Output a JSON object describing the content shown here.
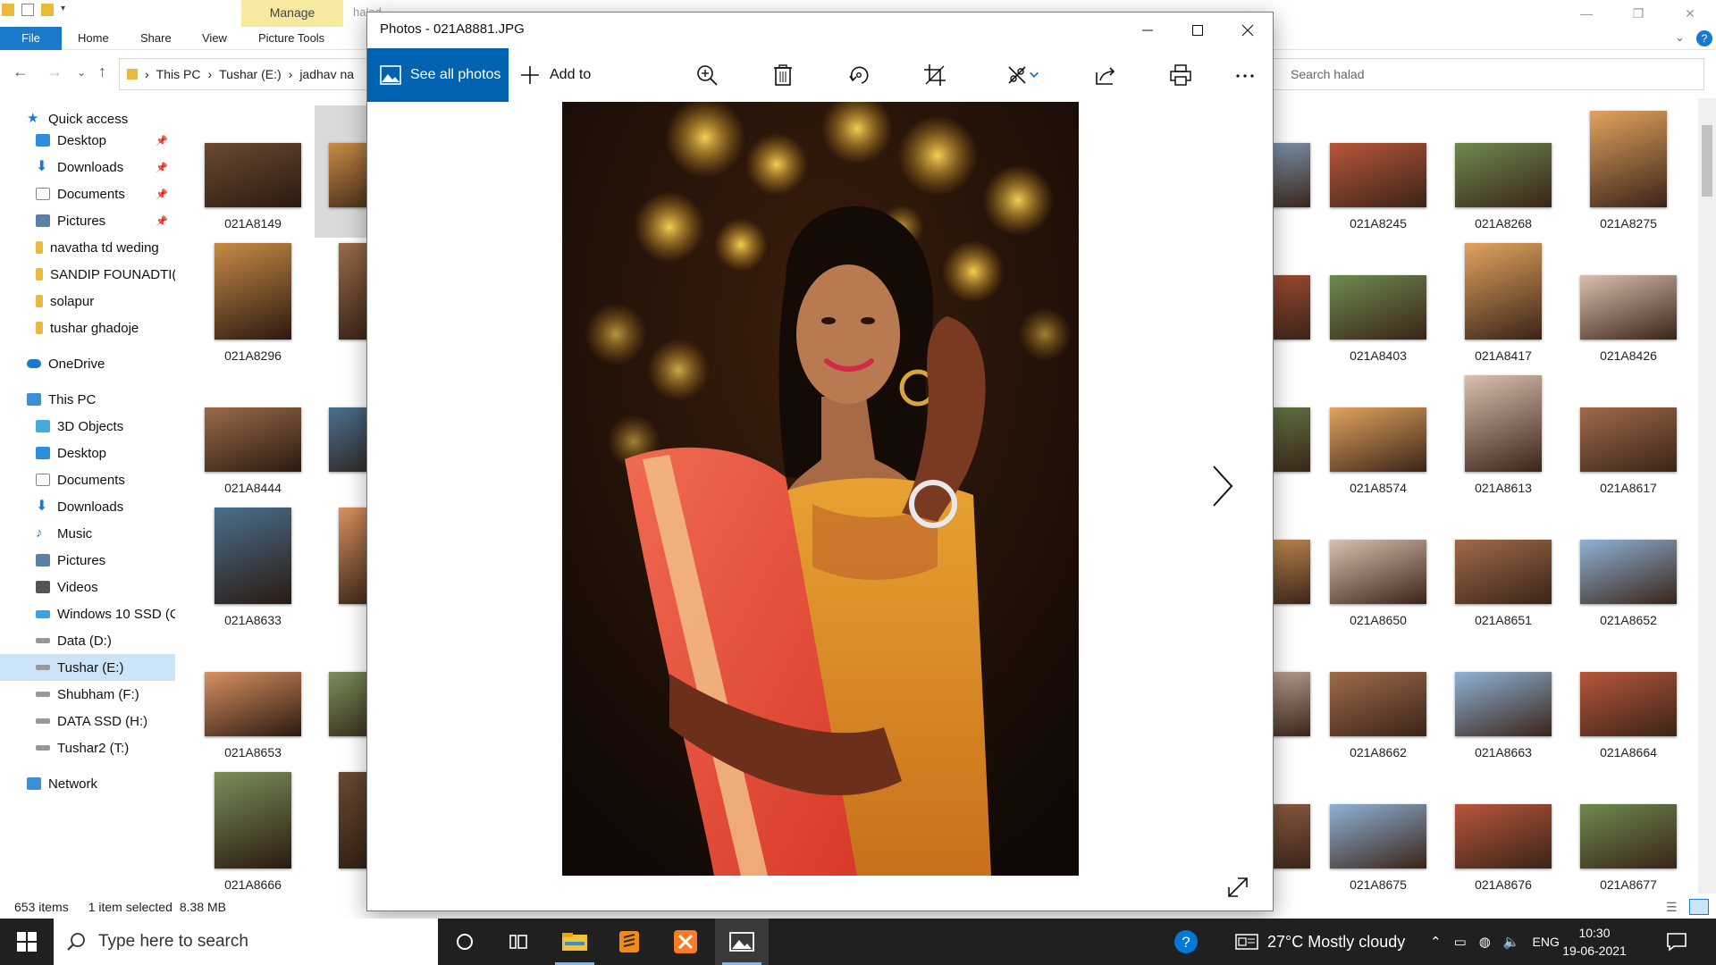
{
  "explorer": {
    "manage_tab": "Manage",
    "title": "halad",
    "ribbon": {
      "file": "File",
      "tabs": [
        "Home",
        "Share",
        "View",
        "Picture Tools"
      ]
    },
    "address": {
      "parts": [
        "This PC",
        "Tushar (E:)",
        "jadhav na"
      ]
    },
    "search": {
      "placeholder": "Search halad"
    },
    "nav": {
      "quick_access": "Quick access",
      "quick_items": [
        "Desktop",
        "Downloads",
        "Documents",
        "Pictures",
        "navatha td weding",
        "SANDIP FOUNADTI(",
        "solapur",
        "tushar ghadoje"
      ],
      "onedrive": "OneDrive",
      "this_pc": "This PC",
      "pc_items": [
        "3D Objects",
        "Desktop",
        "Documents",
        "Downloads",
        "Music",
        "Pictures",
        "Videos",
        "Windows 10 SSD (C",
        "Data (D:)",
        "Tushar (E:)",
        "Shubham (F:)",
        "DATA SSD (H:)",
        "Tushar2 (T:)"
      ],
      "network": "Network"
    },
    "files_left": [
      [
        "021A8149",
        "02"
      ],
      [
        "021A8296",
        "02"
      ],
      [
        "021A8444",
        "02"
      ],
      [
        "021A8633",
        "02"
      ],
      [
        "021A8653",
        "02"
      ],
      [
        "021A8666",
        "02"
      ]
    ],
    "files_right": [
      [
        "31",
        "021A8245",
        "021A8268",
        "021A8275"
      ],
      [
        "90",
        "021A8403",
        "021A8417",
        "021A8426"
      ],
      [
        "70",
        "021A8574",
        "021A8613",
        "021A8617"
      ],
      [
        "49",
        "021A8650",
        "021A8651",
        "021A8652"
      ],
      [
        "61",
        "021A8662",
        "021A8663",
        "021A8664"
      ],
      [
        "74",
        "021A8675",
        "021A8676",
        "021A8677"
      ]
    ],
    "status": {
      "count": "653 items",
      "selected": "1 item selected",
      "size": "8.38 MB"
    }
  },
  "photos": {
    "title": "Photos - 021A8881.JPG",
    "see_all": "See all photos",
    "add_to": "Add to",
    "toolbar_icons": [
      "zoom-icon",
      "delete-icon",
      "rotate-icon",
      "crop-icon",
      "edit-icon",
      "share-icon",
      "print-icon",
      "more-icon"
    ]
  },
  "taskbar": {
    "search_placeholder": "Type here to search",
    "weather": "27°C  Mostly cloudy",
    "lang": "ENG",
    "time": "10:30",
    "date": "19-06-2021"
  },
  "colors": {
    "accent": "#0063b1",
    "file_tab": "#1979ca",
    "manage_tab": "#f8e9a0",
    "taskbar": "#202020"
  }
}
